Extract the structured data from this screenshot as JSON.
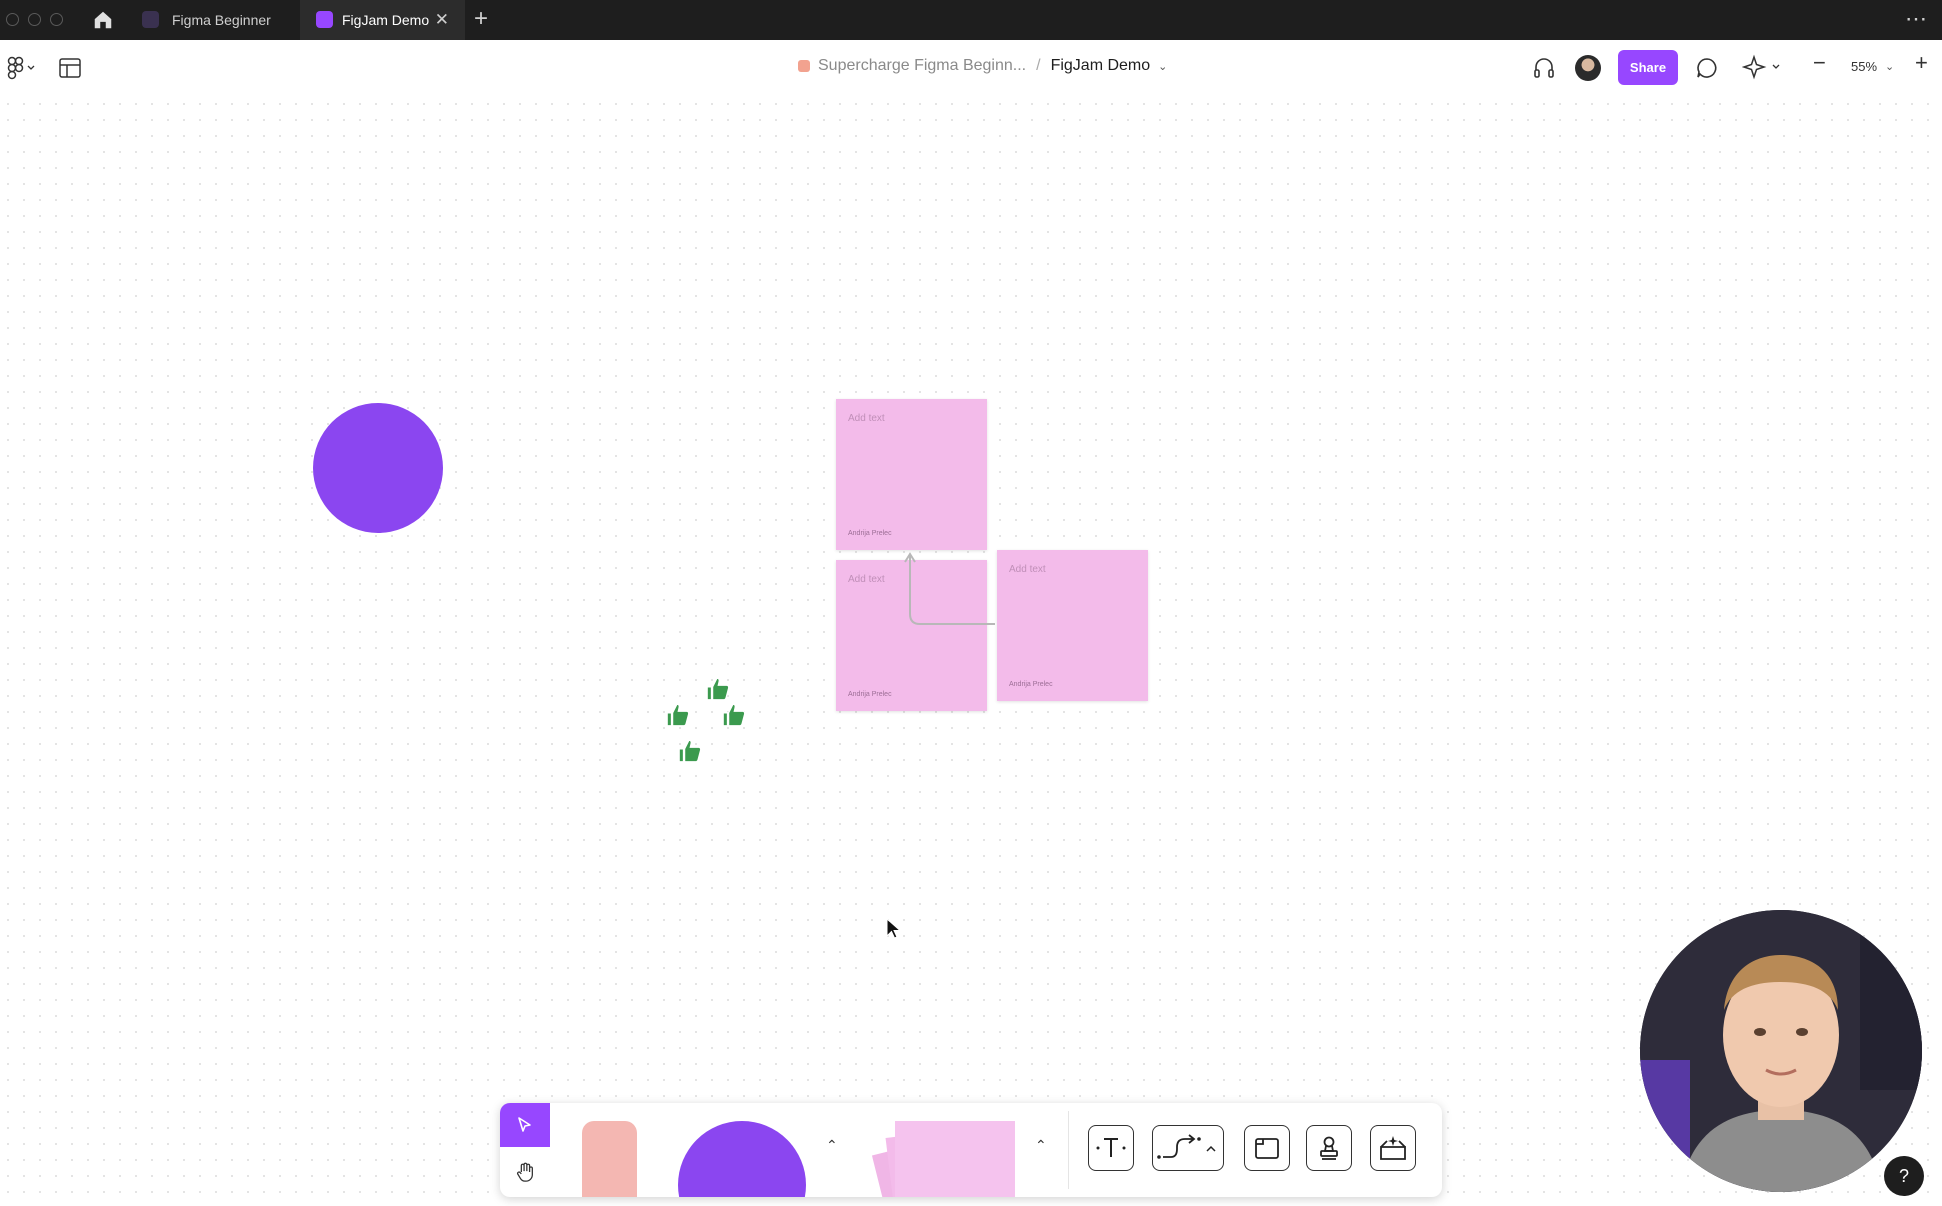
{
  "tabs": [
    {
      "label": "Figma Beginner",
      "active": false
    },
    {
      "label": "FigJam Demo",
      "active": true
    }
  ],
  "toolbar": {
    "project": "Supercharge Figma Beginn...",
    "separator": "/",
    "file": "FigJam Demo",
    "share_label": "Share",
    "zoom": "55%"
  },
  "canvas": {
    "stickies": [
      {
        "placeholder": "Add text",
        "author": "Andrija Prelec"
      },
      {
        "placeholder": "Add text",
        "author": "Andrija Prelec"
      },
      {
        "placeholder": "Add text",
        "author": "Andrija Prelec"
      }
    ],
    "shape_color": "#8b46f0",
    "sticky_color": "#f3bbea",
    "reactions": [
      "thumbs-up",
      "thumbs-up",
      "thumbs-up",
      "thumbs-up"
    ]
  },
  "dock": {
    "tools": [
      "select",
      "hand",
      "marker",
      "shape",
      "sticky-notes",
      "text",
      "connector",
      "section",
      "stamp",
      "widgets"
    ]
  },
  "help_label": "?",
  "colors": {
    "accent": "#9747ff",
    "tabbar": "#1e1e1e"
  }
}
